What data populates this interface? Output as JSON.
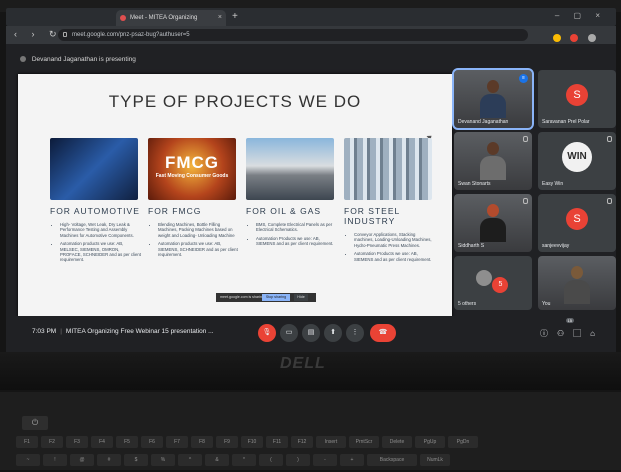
{
  "browser": {
    "tab_title": "Meet - MITEA Organizing",
    "tab_close": "×",
    "new_tab": "+",
    "window_controls": "–  ▢  ×",
    "nav_buttons": "‹ › ↻",
    "url": "meet.google.com/pnz-psaz-bug?authuser=5"
  },
  "meet": {
    "presenting_text": "Devanand Jaganathan is presenting",
    "slide": {
      "title": "TYPE OF PROJECTS WE DO",
      "fmcg_logo": "FMCG",
      "fmcg_logo_sub": "Fast Moving Consumer Goods",
      "columns": [
        {
          "heading": "FOR AUTOMOTIVE",
          "bullets": [
            "High- Voltage, Wet Leak, Dry Leak & Performance Testing and Assembly Machines for Automotive Components.",
            "Automation products we use: AB, MELSEC, SIEMENS, OMRON, PROFACE, SCHNEIDER and as per client requirement."
          ]
        },
        {
          "heading": "FOR FMCG",
          "bullets": [
            "Blending Machines, Bottle Filling Machines, Packing Machines based on weight and Loading- Unloading Machine",
            "Automation products we use: AB, SIEMENS, SCHNEIDER and as per client requirement."
          ]
        },
        {
          "heading": "FOR OIL & GAS",
          "bullets": [
            "BMS, Complete Electrical Panels as per Electrical Schematics.",
            "Automation Products we use: AB, SIEMENS and as per client requirement."
          ]
        },
        {
          "heading": "FOR STEEL INDUSTRY",
          "bullets": [
            "Conveyor Applications, Stacking machines, Loading-Unloading Machines, Hydro-Pneumatic Press Machines.",
            "Automation Products we use: AB, SIEMENS and as per client requirement."
          ]
        }
      ],
      "share_bar": {
        "message": "meet.google.com is sharing your screen.",
        "stop_label": "Stop sharing",
        "hide_label": "Hide"
      }
    },
    "participants": [
      {
        "name": "Devanand Jaganathan",
        "type": "video",
        "active": true
      },
      {
        "name": "Saravanan Prel Polar",
        "initial": "S",
        "color": "#e94235"
      },
      {
        "name": "Swan Stonarts",
        "type": "video"
      },
      {
        "name": "Easy Win",
        "logo": "WIN"
      },
      {
        "name": "Siddharth S",
        "type": "video"
      },
      {
        "name": "sanjeevvijay",
        "initial": "S",
        "color": "#e94235"
      },
      {
        "name": "5 others",
        "count": "5"
      },
      {
        "name": "You",
        "type": "video"
      }
    ],
    "bottom_bar": {
      "time": "7:03 PM",
      "meeting_title": "MITEA Organizing Free Webinar 15 presentation ...",
      "people_badge": "15",
      "end_call_label": "☎"
    }
  },
  "hardware": {
    "brand": "DELL",
    "keys_row1": [
      "F1",
      "F2",
      "F3",
      "F4",
      "F5",
      "F6",
      "F7",
      "F8",
      "F9",
      "F10",
      "F11",
      "F12",
      "Insert",
      "PrntScr",
      "Delete",
      "PgUp",
      "PgDn"
    ],
    "keys_row3": [
      "~",
      "!",
      "@",
      "#",
      "$",
      "%",
      "^",
      "&",
      "*",
      "(",
      ")",
      "-",
      "+",
      "Backspace",
      "NumLk"
    ],
    "power_key": "⏻"
  }
}
